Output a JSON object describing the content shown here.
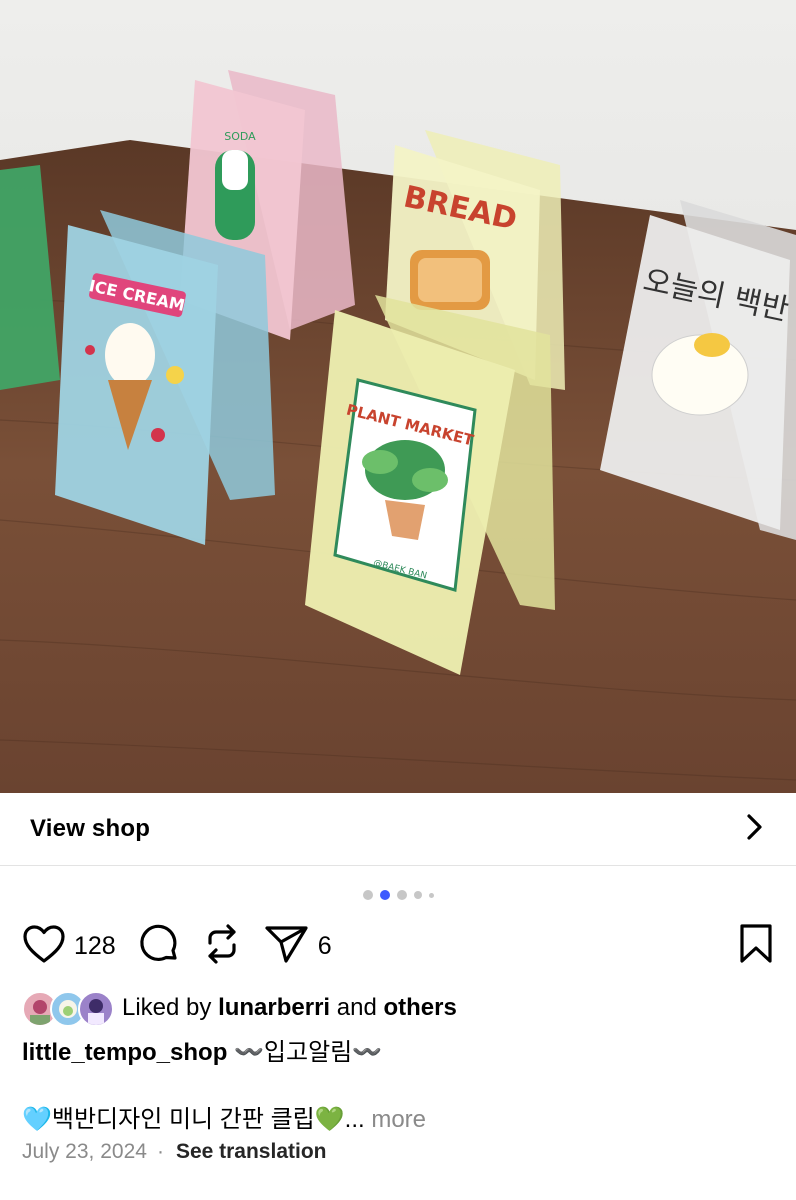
{
  "post": {
    "image_alt": "Mini acrylic signboard clips",
    "sign_texts": {
      "ice_cream": "ICE CREAM",
      "bread": "BREAD",
      "plant_market": "PLANT MARKET",
      "plant_credit": "@BAEK BAN",
      "korean_sign": "오늘의 백반"
    }
  },
  "shop": {
    "label": "View shop",
    "icon": "chevron-right-icon"
  },
  "carousel": {
    "total": 5,
    "active_index": 1
  },
  "actions": {
    "likes_count": "128",
    "shares_count": "6",
    "icons": [
      "heart-icon",
      "comment-icon",
      "repost-icon",
      "send-icon",
      "bookmark-icon"
    ]
  },
  "liked_by": {
    "prefix": "Liked by ",
    "user": "lunarberri",
    "middle": " and ",
    "others": "others"
  },
  "caption": {
    "username": "little_tempo_shop",
    "headline": "〰️입고알림〰️",
    "body": "🩵백반디자인 미니 간판 클립💚",
    "ellipsis": "... ",
    "more": "more"
  },
  "meta": {
    "date": "July 23, 2024",
    "separator": "·",
    "translate": "See translation"
  },
  "colors": {
    "accent": "#3d5afe",
    "muted": "#8a8a8a",
    "text": "#000000"
  }
}
